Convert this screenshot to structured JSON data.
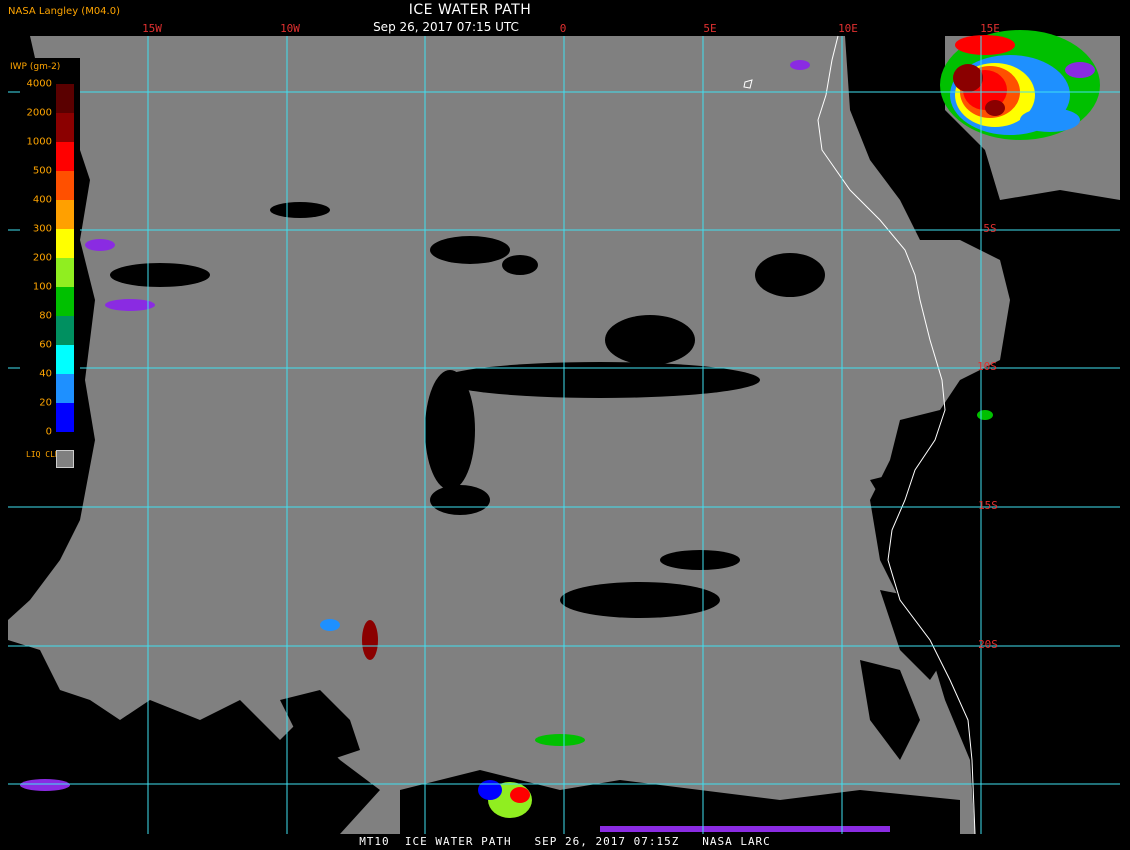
{
  "header": {
    "producer": "NASA Langley (M04.0)",
    "title": "ICE WATER PATH",
    "datetime": "Sep 26, 2017 07:15 UTC"
  },
  "footer": {
    "text": "MT10  ICE WATER PATH   SEP 26, 2017 07:15Z   NASA LARC"
  },
  "grid": {
    "longitude_labels": [
      "15W",
      "10W",
      "0",
      "5E",
      "10E",
      "15E"
    ],
    "latitude_labels": [
      "5S",
      "10S",
      "15S",
      "20S"
    ]
  },
  "legend": {
    "unit_label": "IWP (gm-2)",
    "entries": [
      {
        "value": "4000",
        "color": "#5a0000"
      },
      {
        "value": "2000",
        "color": "#8b0000"
      },
      {
        "value": "1000",
        "color": "#ff0000"
      },
      {
        "value": "500",
        "color": "#ff5000"
      },
      {
        "value": "400",
        "color": "#ffa000"
      },
      {
        "value": "300",
        "color": "#ffff00"
      },
      {
        "value": "200",
        "color": "#90ee20"
      },
      {
        "value": "100",
        "color": "#00c000"
      },
      {
        "value": "80",
        "color": "#009060"
      },
      {
        "value": "60",
        "color": "#00ffff"
      },
      {
        "value": "40",
        "color": "#1e90ff"
      },
      {
        "value": "20",
        "color": "#0000ff"
      },
      {
        "value": "0",
        "color": "#8a2be2"
      }
    ],
    "liquid_cloud_label": "LIQ CLD",
    "liquid_cloud_color": "#808080"
  },
  "colors": {
    "grid": "#40e0f0",
    "label": "#e03030",
    "liquid_cloud": "#808080",
    "clear": "#000000",
    "coast": "#ffffff"
  }
}
